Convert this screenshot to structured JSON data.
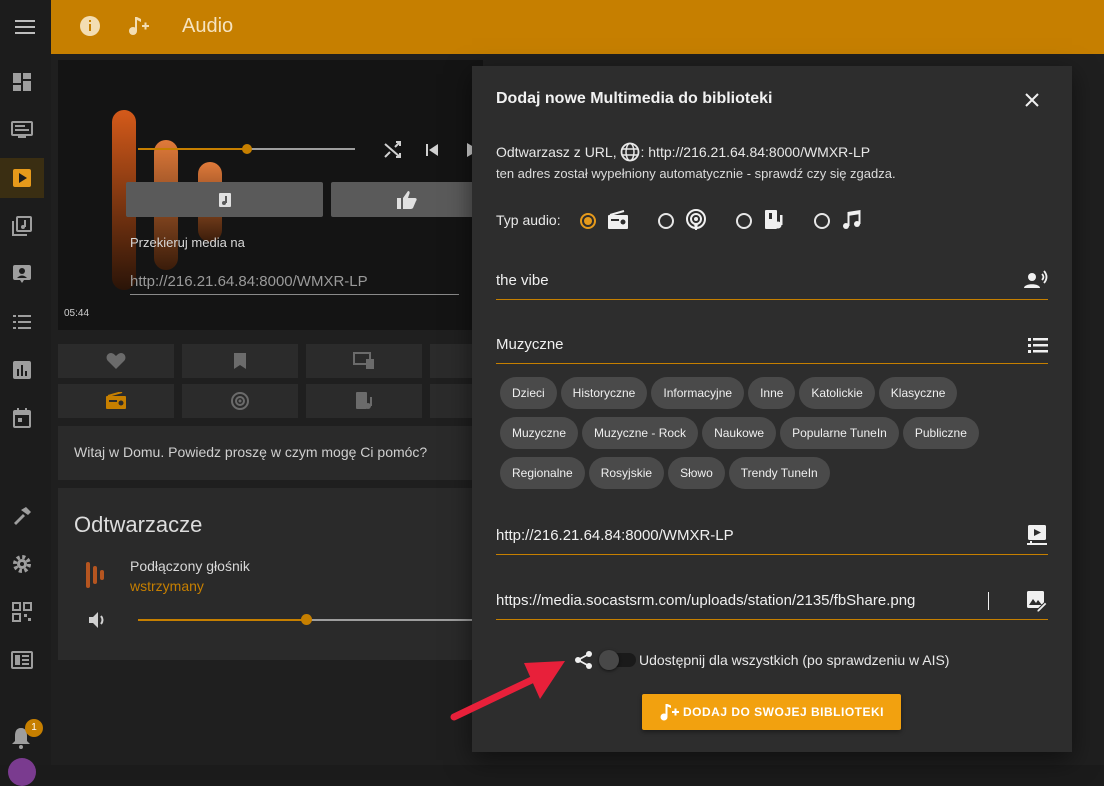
{
  "topbar": {
    "title": "Audio"
  },
  "player": {
    "redirect_label": "Przekieruj media na",
    "redirect_placeholder": "http://216.21.64.84:8000/WMXR-LP",
    "time": "05:44"
  },
  "assistant": {
    "greeting": "Witaj w Domu. Powiedz proszę w czym mogę Ci pomóc?"
  },
  "players": {
    "title": "Odtwarzacze",
    "speaker_name": "Podłączony głośnik",
    "speaker_status": "wstrzymany"
  },
  "notifications": {
    "count": "1"
  },
  "dialog": {
    "title": "Dodaj nowe Multimedia do biblioteki",
    "url_prefix": "Odtwarzasz z URL,",
    "url_value": ": http://216.21.64.84:8000/WMXR-LP",
    "url_note": "ten adres został wypełniony automatycznie - sprawdź czy się zgadza.",
    "audio_type_label": "Typ audio:",
    "name_value": "the vibe",
    "category_value": "Muzyczne",
    "categories": [
      "Dzieci",
      "Historyczne",
      "Informacyjne",
      "Inne",
      "Katolickie",
      "Klasyczne",
      "Muzyczne",
      "Muzyczne - Rock",
      "Naukowe",
      "Popularne TuneIn",
      "Publiczne",
      "Regionalne",
      "Rosyjskie",
      "Słowo",
      "Trendy TuneIn"
    ],
    "stream_url": "http://216.21.64.84:8000/WMXR-LP",
    "image_url": "https://media.socastsrm.com/uploads/station/2135/fbShare.png",
    "share_label": "Udostępnij dla wszystkich (po sprawdzeniu w AIS)",
    "add_button": "DODAJ DO SWOJEJ BIBLIOTEKI"
  },
  "colors": {
    "accent": "#c67f00",
    "button": "#f2a10f",
    "arrow": "#e8203a"
  }
}
